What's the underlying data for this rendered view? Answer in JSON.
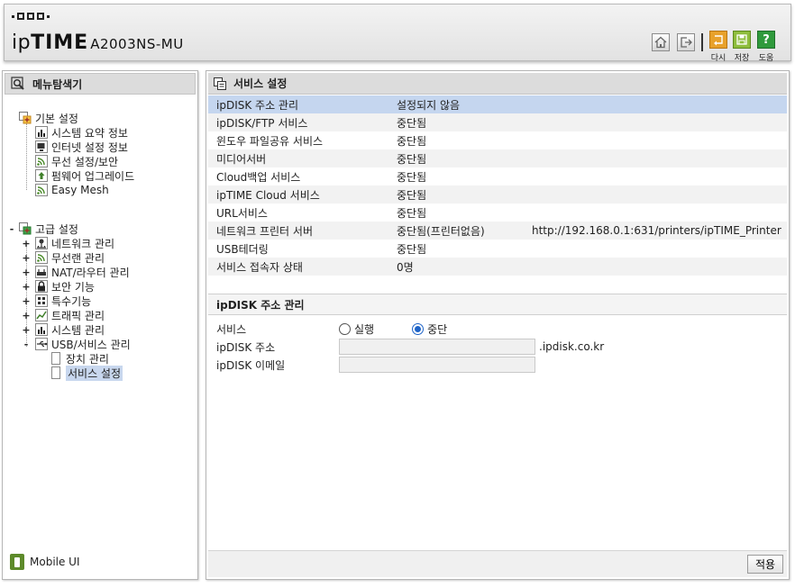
{
  "header": {
    "brand_a": "ip",
    "brand_b": "TIME",
    "model": "A2003NS-MU",
    "buttons": {
      "home": "home-icon",
      "logout": "logout-icon",
      "reload_label": "다시",
      "save_label": "저장",
      "help_label": "도움",
      "help_glyph": "?"
    },
    "colors": {
      "reload": "#e8a12b",
      "save": "#8ebd3d",
      "help": "#2f9a3c"
    }
  },
  "sidebar": {
    "title": "메뉴탐색기",
    "basic": {
      "label": "기본 설정",
      "items": [
        "시스템 요약 정보",
        "인터넷 설정 정보",
        "무선 설정/보안",
        "펌웨어 업그레이드",
        "Easy Mesh"
      ]
    },
    "advanced": {
      "label": "고급 설정",
      "expand_glyph": "-",
      "items": [
        {
          "label": "네트워크 관리",
          "glyph": "+"
        },
        {
          "label": "무선랜 관리",
          "glyph": "+"
        },
        {
          "label": "NAT/라우터 관리",
          "glyph": "+"
        },
        {
          "label": "보안 기능",
          "glyph": "+"
        },
        {
          "label": "특수기능",
          "glyph": "+"
        },
        {
          "label": "트래픽 관리",
          "glyph": "+"
        },
        {
          "label": "시스템 관리",
          "glyph": "+"
        },
        {
          "label": "USB/서비스 관리",
          "glyph": "-"
        }
      ],
      "usb_children": [
        "장치 관리",
        "서비스 설정"
      ]
    },
    "mobile_ui": "Mobile UI"
  },
  "main": {
    "title": "서비스 설정",
    "services": [
      {
        "name": "ipDISK 주소 관리",
        "status": "설정되지 않음",
        "extra": ""
      },
      {
        "name": "ipDISK/FTP 서비스",
        "status": "중단됨",
        "extra": ""
      },
      {
        "name": "윈도우 파일공유 서비스",
        "status": "중단됨",
        "extra": ""
      },
      {
        "name": "미디어서버",
        "status": "중단됨",
        "extra": ""
      },
      {
        "name": "Cloud백업 서비스",
        "status": "중단됨",
        "extra": ""
      },
      {
        "name": "ipTIME Cloud 서비스",
        "status": "중단됨",
        "extra": ""
      },
      {
        "name": "URL서비스",
        "status": "중단됨",
        "extra": ""
      },
      {
        "name": "네트워크 프린터 서버",
        "status": "중단됨(프린터없음)",
        "extra": "http://192.168.0.1:631/printers/ipTIME_Printer"
      },
      {
        "name": "USB테더링",
        "status": "중단됨",
        "extra": ""
      },
      {
        "name": "서비스 접속자 상태",
        "status": "0명",
        "extra": ""
      }
    ],
    "section": {
      "title": "ipDISK 주소 관리",
      "service_label": "서비스",
      "radio_run": "실행",
      "radio_stop": "중단",
      "selected": "중단",
      "address_label": "ipDISK 주소",
      "address_value": "",
      "address_suffix": ".ipdisk.co.kr",
      "email_label": "ipDISK 이메일",
      "email_value": ""
    },
    "apply": "적용"
  }
}
